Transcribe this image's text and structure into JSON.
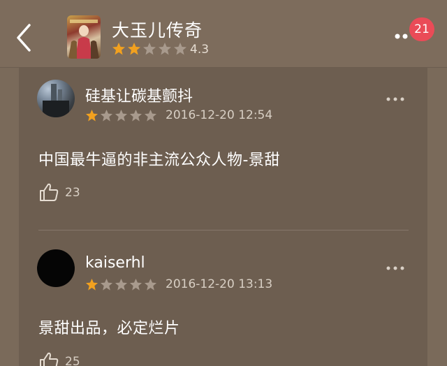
{
  "header": {
    "title": "大玉儿传奇",
    "rating": "4.3",
    "stars_filled": 2,
    "stars_total": 5,
    "badge_count": "21"
  },
  "reviews": [
    {
      "username": "硅基让碳基颤抖",
      "date": "2016-12-20 12:54",
      "stars_filled": 1,
      "stars_total": 5,
      "comment": "中国最牛逼的非主流公众人物-景甜",
      "likes": "23"
    },
    {
      "username": "kaiserhl",
      "date": "2016-12-20 13:13",
      "stars_filled": 1,
      "stars_total": 5,
      "comment": "景甜出品，必定烂片",
      "likes": "25"
    }
  ],
  "colors": {
    "star_filled": "#f2a11f",
    "star_empty": "#a89a8d",
    "badge": "#ea4b57"
  }
}
